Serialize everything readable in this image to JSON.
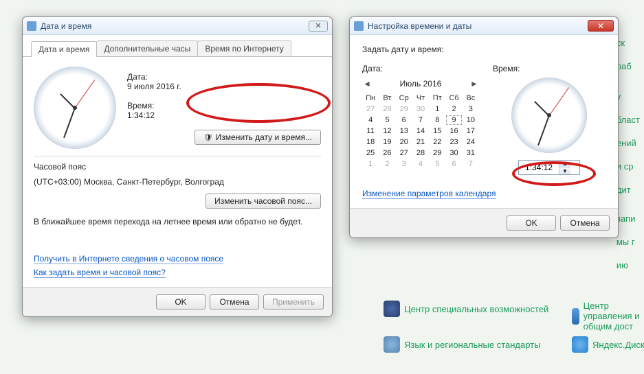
{
  "bg": {
    "items": [
      "Центр специальных возможностей",
      "Центр управления и общим дост",
      "Язык и региональные стандарты",
      "Яндекс.Диск"
    ],
    "fragments": [
      "ск",
      "раб",
      "у",
      "бласт",
      "ений",
      "и ср",
      "дит",
      "запи",
      "мы г",
      "ию"
    ]
  },
  "dialog1": {
    "title": "Дата и время",
    "tabs": [
      "Дата и время",
      "Дополнительные часы",
      "Время по Интернету"
    ],
    "date_label": "Дата:",
    "date_value": "9 июля 2016 г.",
    "time_label": "Время:",
    "time_value": "1:34:12",
    "change_dt_btn": "Изменить дату и время...",
    "tz_heading": "Часовой пояс",
    "tz_value": "(UTC+03:00) Москва, Санкт-Петербург, Волгоград",
    "change_tz_btn": "Изменить часовой пояс...",
    "dst_note": "В ближайшее время перехода на летнее время или обратно не будет.",
    "link1": "Получить в Интернете сведения о часовом поясе",
    "link2": "Как задать время и часовой пояс?",
    "ok": "OK",
    "cancel": "Отмена",
    "apply": "Применить"
  },
  "dialog2": {
    "title": "Настройка времени и даты",
    "heading": "Задать дату и время:",
    "date_label": "Дата:",
    "time_label": "Время:",
    "cal": {
      "title": "Июль 2016",
      "dow": [
        "Пн",
        "Вт",
        "Ср",
        "Чт",
        "Пт",
        "Сб",
        "Вс"
      ],
      "lead": [
        27,
        28,
        29,
        30
      ],
      "days": [
        1,
        2,
        3,
        4,
        5,
        6,
        7,
        8,
        9,
        10,
        11,
        12,
        13,
        14,
        15,
        16,
        17,
        18,
        19,
        20,
        21,
        22,
        23,
        24,
        25,
        26,
        27,
        28,
        29,
        30,
        31
      ],
      "trail": [
        1,
        2,
        3,
        4,
        5,
        6,
        7
      ],
      "today": 9
    },
    "time_value": "1:34:12",
    "cal_link": "Изменение параметров календаря",
    "ok": "OK",
    "cancel": "Отмена"
  }
}
